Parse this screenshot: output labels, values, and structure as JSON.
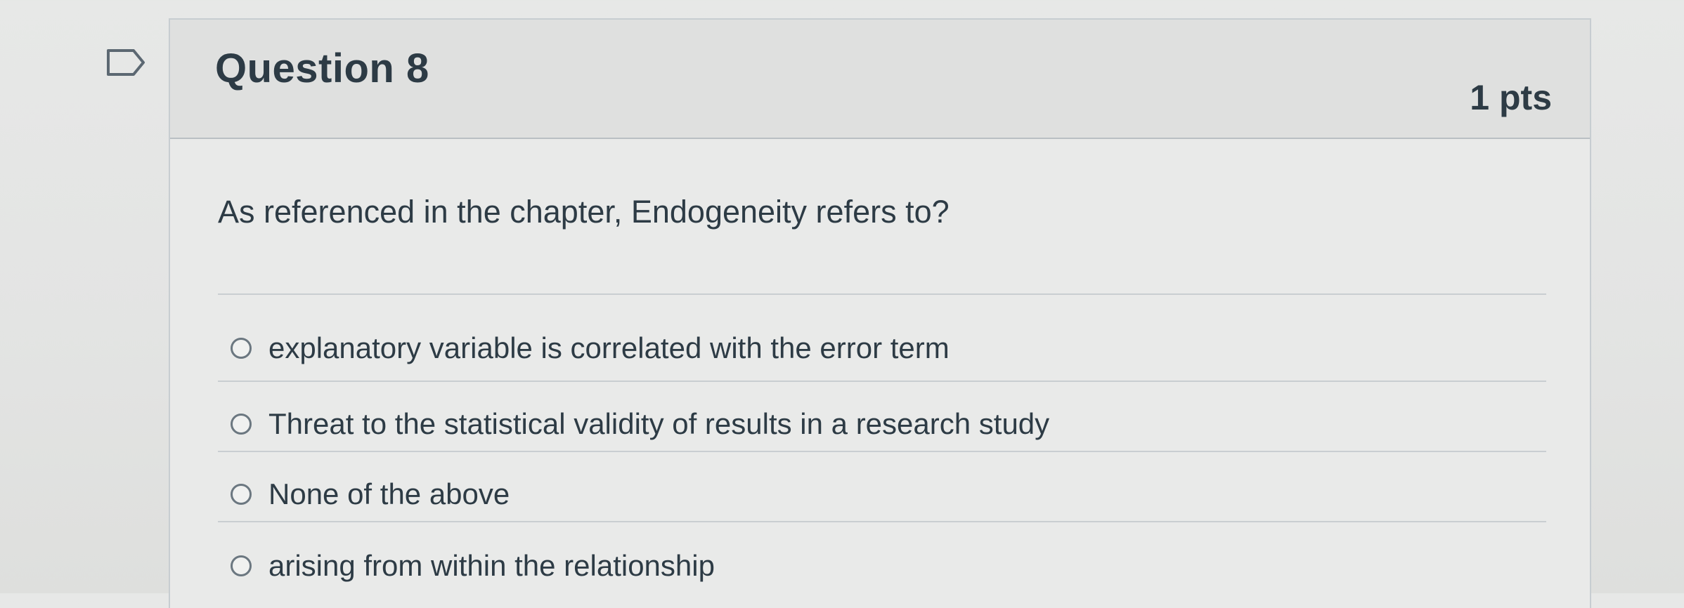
{
  "question": {
    "title": "Question 8",
    "points": "1 pts",
    "text": "As referenced in the chapter, Endogeneity refers to?"
  },
  "answers": [
    {
      "label": "explanatory variable is correlated with the error term",
      "selected": false
    },
    {
      "label": "Threat to the statistical validity of results in a research study",
      "selected": false
    },
    {
      "label": "None of the above",
      "selected": false
    },
    {
      "label": "arising from within the relationship",
      "selected": false
    }
  ],
  "icons": {
    "flag": "bookmark-flag-icon",
    "radio": "radio-button-icon"
  },
  "colors": {
    "text": "#2d3b45",
    "header_bg": "#dfe0df",
    "border": "#c7cdd1"
  }
}
